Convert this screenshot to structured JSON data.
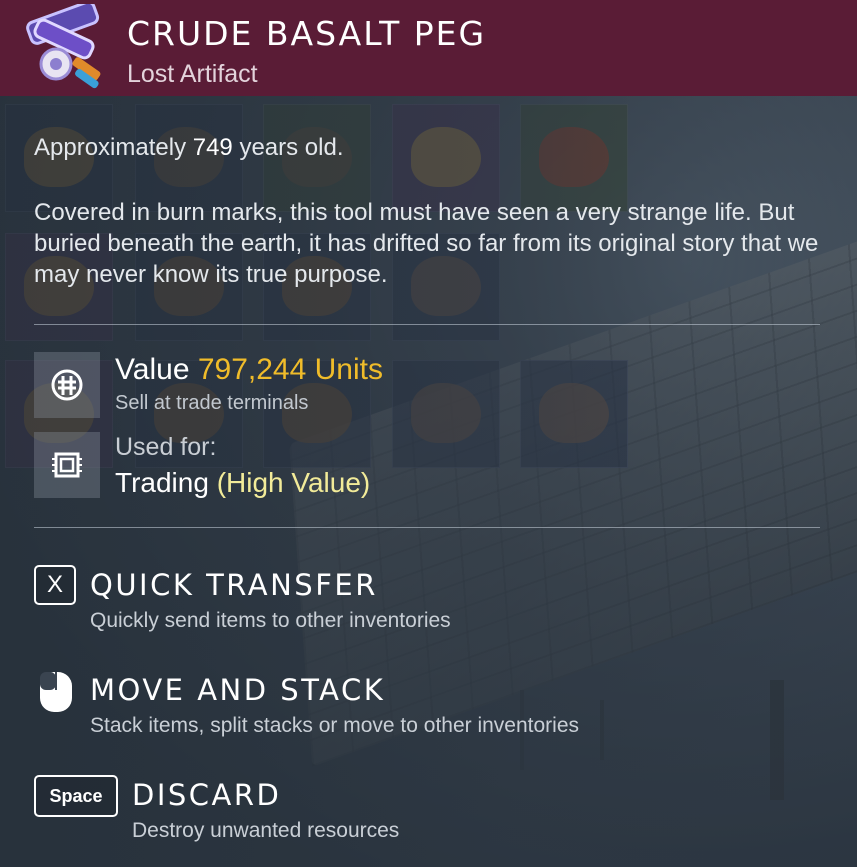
{
  "item": {
    "name": "CRUDE BASALT PEG",
    "category": "Lost Artifact",
    "icon": "artifact-icon",
    "header_color": "#5a1c36"
  },
  "description": {
    "age_prefix": "Approximately ",
    "age_value": "749",
    "age_suffix": " years old.",
    "story": "Covered in burn marks, this tool must have seen a very strange life. But buried beneath the earth, it has drifted so far from its original story that we may never know its true purpose."
  },
  "stats": {
    "value_label": "Value ",
    "value_amount": "797,244 Units",
    "value_sub": "Sell at trade terminals",
    "value_icon": "units-icon",
    "value_color": "#f0bc2a",
    "used_label": "Used for:",
    "used_value": "Trading ",
    "used_highlight": "(High Value)",
    "used_icon": "trade-chip-icon",
    "used_highlight_color": "#f2eb99"
  },
  "actions": [
    {
      "key": "X",
      "title": "QUICK TRANSFER",
      "subtitle": "Quickly send items to other inventories"
    },
    {
      "key": "mouse-icon",
      "title": "MOVE AND STACK",
      "subtitle": "Stack items, split stacks or move to other inventories"
    },
    {
      "key": "Space",
      "title": "DISCARD",
      "subtitle": "Destroy unwanted resources"
    }
  ]
}
